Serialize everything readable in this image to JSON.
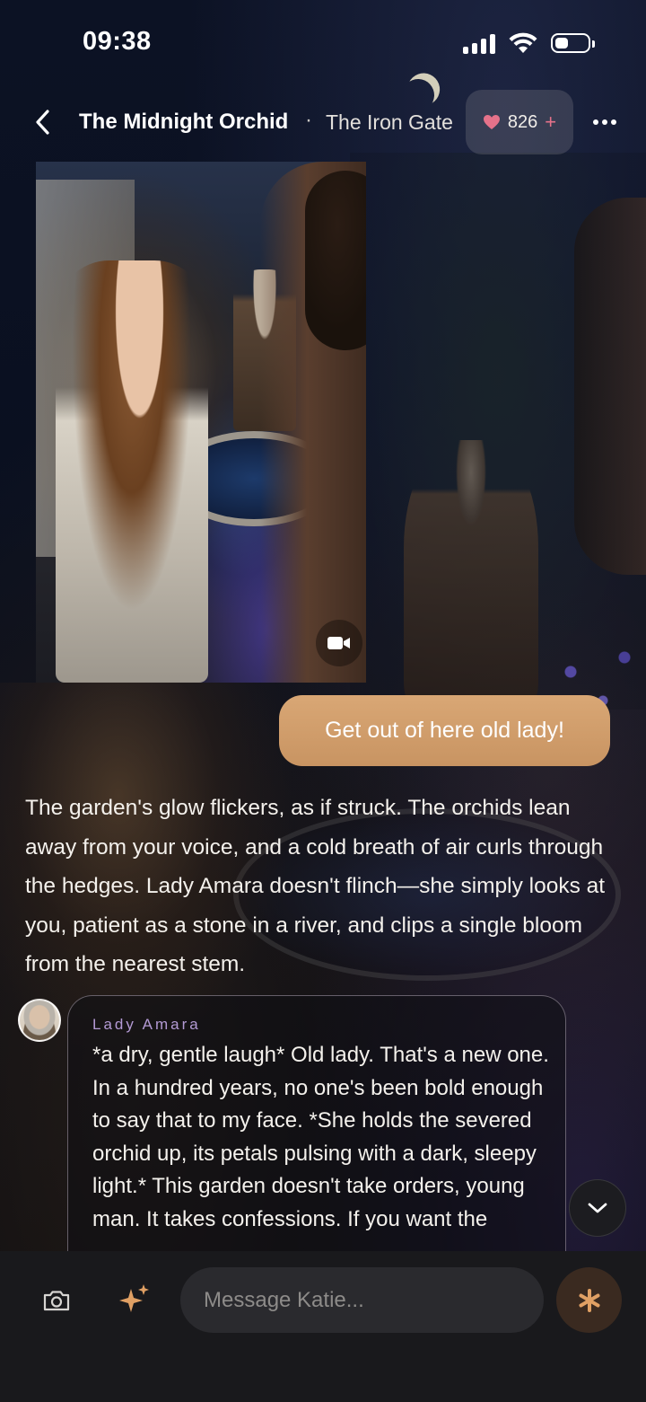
{
  "status_bar": {
    "time": "09:38"
  },
  "header": {
    "title": "The Midnight Orchid",
    "separator": "·",
    "subtitle": "The Iron Gate",
    "likes_count": "826",
    "likes_plus": "+"
  },
  "media": {
    "type_icon": "video-camera-icon"
  },
  "messages": {
    "user_message": "Get out of here old lady!",
    "narration": "The garden's glow flickers, as if struck. The orchids lean away from your voice, and a cold breath of air curls through the hedges. Lady Amara doesn't flinch—she simply looks at you, patient as a stone in a river, and clips a single bloom from the nearest stem.",
    "character": {
      "name": "Lady Amara",
      "text": "*a dry, gentle laugh* Old lady. That's a new one. In a hundred years, no one's been bold enough to say that to my face. *She holds the severed orchid up, its petals pulsing with a dark, sleepy light.* This garden doesn't take orders, young man. It takes confessions. If you want the"
    }
  },
  "composer": {
    "placeholder": "Message Katie...",
    "value": ""
  },
  "colors": {
    "user_bubble": "#d4a06c",
    "heart": "#e6728a",
    "character_name": "#b39ad4",
    "send_star": "#e0a064",
    "composer_bg": "#19191c"
  }
}
